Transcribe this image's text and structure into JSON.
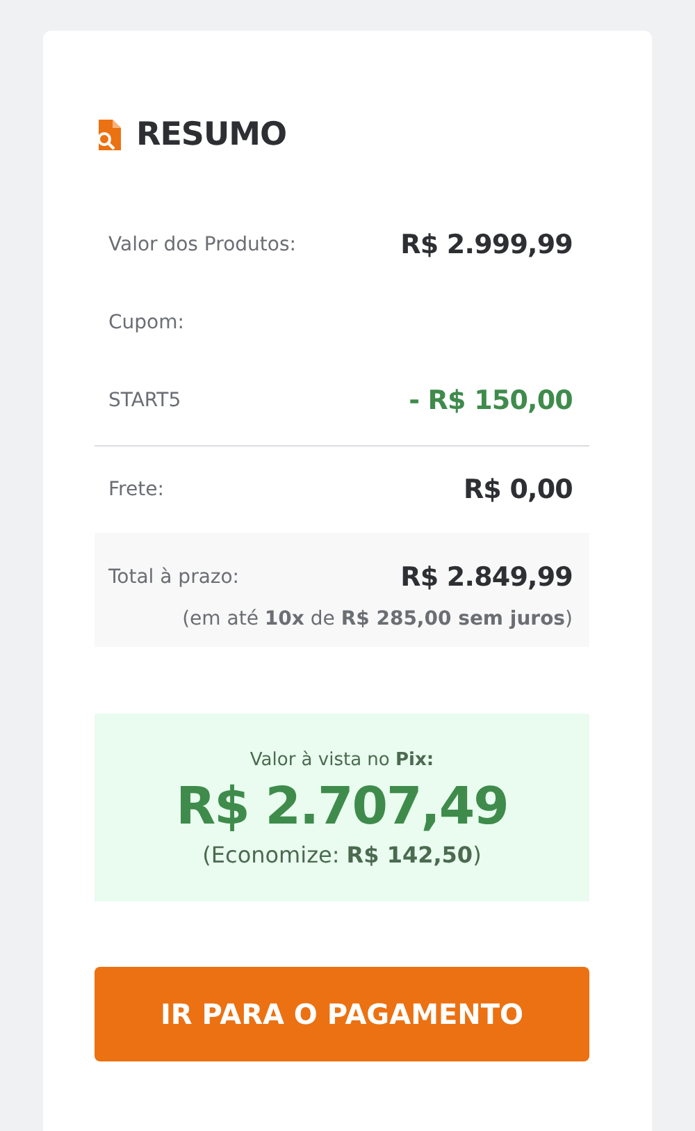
{
  "title": "RESUMO",
  "rows": [
    {
      "label": "Valor dos Produtos:",
      "value": "R$ 2.999,99",
      "kind": "amount"
    },
    {
      "label": "Cupom:",
      "kind": "heading"
    },
    {
      "label": "START5",
      "value": "- R$ 150,00",
      "kind": "discount"
    }
  ],
  "shipping": {
    "label": "Frete:",
    "value": "R$ 0,00"
  },
  "total": {
    "label": "Total à prazo:",
    "value": "R$ 2.849,99",
    "installments": "(em até **10x** de **R$ 285,00 sem juros**)"
  },
  "pix": {
    "label": "Valor à vista no **Pix:**",
    "value": "R$ 2.707,49",
    "savings": "(Economize: **R$ 142,50**)"
  },
  "button": "IR PARA O PAGAMENTO"
}
